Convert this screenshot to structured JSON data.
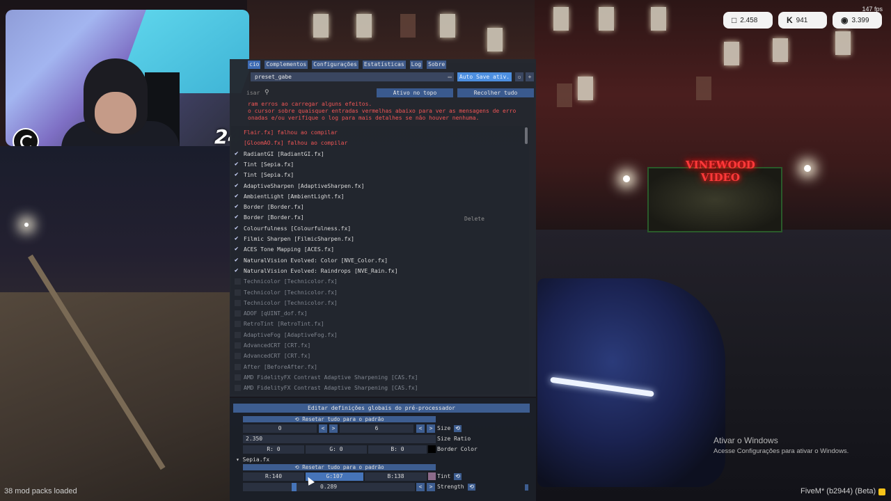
{
  "overlay": {
    "fps": "147 fps",
    "badges": [
      {
        "icon": "chat-icon",
        "value": "2.458"
      },
      {
        "icon": "kick-icon",
        "value": "941"
      },
      {
        "icon": "globe-icon",
        "value": "3.399"
      }
    ],
    "webcam_number": "24",
    "mod_packs": "38 mod packs loaded",
    "activate_windows_title": "Ativar o Windows",
    "activate_windows_sub": "Acesse Configurações para ativar o Windows.",
    "fivem": "FiveM* (b2944) (Beta)",
    "neon_sign_1": "VINEWOOD",
    "neon_sign_2": "VIDEO"
  },
  "reshade": {
    "menu": [
      "cio",
      "Complementos",
      "Configurações",
      "Estatísticas",
      "Log",
      "Sobre"
    ],
    "preset": "preset_gabe",
    "autosave": "Auto Save ativ.",
    "search_placeholder": "isar",
    "btn_top": "Ativo no topo",
    "btn_collapse": "Recolher tudo",
    "error_lines": [
      "ram erros ao carregar alguns efeitos.",
      "o cursor sobre quaisquer entradas vermelhas abaixo para ver as mensagens de erro",
      "onadas e/ou verifique o log para mais detalhes se não houver nenhuma."
    ],
    "delete": "Delete",
    "effects": [
      {
        "label": "Flair.fx] falhou ao compilar",
        "state": "err"
      },
      {
        "label": "[GloomAO.fx] falhou ao compilar",
        "state": "err"
      },
      {
        "label": "RadiantGI [RadiantGI.fx]",
        "state": "on"
      },
      {
        "label": "Tint [Sepia.fx]",
        "state": "on"
      },
      {
        "label": "Tint [Sepia.fx]",
        "state": "on"
      },
      {
        "label": "AdaptiveSharpen [AdaptiveSharpen.fx]",
        "state": "on"
      },
      {
        "label": "AmbientLight [AmbientLight.fx]",
        "state": "on"
      },
      {
        "label": "Border [Border.fx]",
        "state": "on"
      },
      {
        "label": "Border [Border.fx]",
        "state": "on"
      },
      {
        "label": "Colourfulness [Colourfulness.fx]",
        "state": "on"
      },
      {
        "label": "Filmic Sharpen [FilmicSharpen.fx]",
        "state": "on"
      },
      {
        "label": "ACES Tone Mapping [ACES.fx]",
        "state": "on"
      },
      {
        "label": "NaturalVision Evolved: Color [NVE_Color.fx]",
        "state": "on"
      },
      {
        "label": "NaturalVision Evolved: Raindrops [NVE_Rain.fx]",
        "state": "on"
      },
      {
        "label": "Technicolor [Technicolor.fx]",
        "state": "off"
      },
      {
        "label": "Technicolor [Technicolor.fx]",
        "state": "off"
      },
      {
        "label": "Technicolor [Technicolor.fx]",
        "state": "off"
      },
      {
        "label": "ADOF [qUINT_dof.fx]",
        "state": "off"
      },
      {
        "label": "RetroTint [RetroTint.fx]",
        "state": "off"
      },
      {
        "label": "AdaptiveFog [AdaptiveFog.fx]",
        "state": "off"
      },
      {
        "label": "AdvancedCRT [CRT.fx]",
        "state": "off"
      },
      {
        "label": "AdvancedCRT [CRT.fx]",
        "state": "off"
      },
      {
        "label": "After [BeforeAfter.fx]",
        "state": "off"
      },
      {
        "label": "AMD FidelityFX Contrast Adaptive Sharpening [CAS.fx]",
        "state": "off"
      },
      {
        "label": "AMD FidelityFX Contrast Adaptive Sharpening [CAS.fx]",
        "state": "off"
      }
    ]
  },
  "preprocessor": {
    "header": "Editar definições globais do pré-processador",
    "reset": "Resetar tudo para o padrão",
    "size_x": "0",
    "size_y": "6",
    "size_label": "Size",
    "size_ratio_value": "2.350",
    "size_ratio_label": "Size Ratio",
    "border_r": "R:  0",
    "border_g": "G:  0",
    "border_b": "B:  0",
    "border_color_label": "Border Color",
    "sepia_node": "Sepia.fx",
    "tint_r": "R:140",
    "tint_g": "G:107",
    "tint_b": "B:138",
    "tint_label": "Tint",
    "tint_swatch": "#8c6b8a",
    "strength_value": "0.289",
    "strength_label": "Strength",
    "arrow_left": "<",
    "arrow_right": ">",
    "reset_glyph": "⟲"
  }
}
